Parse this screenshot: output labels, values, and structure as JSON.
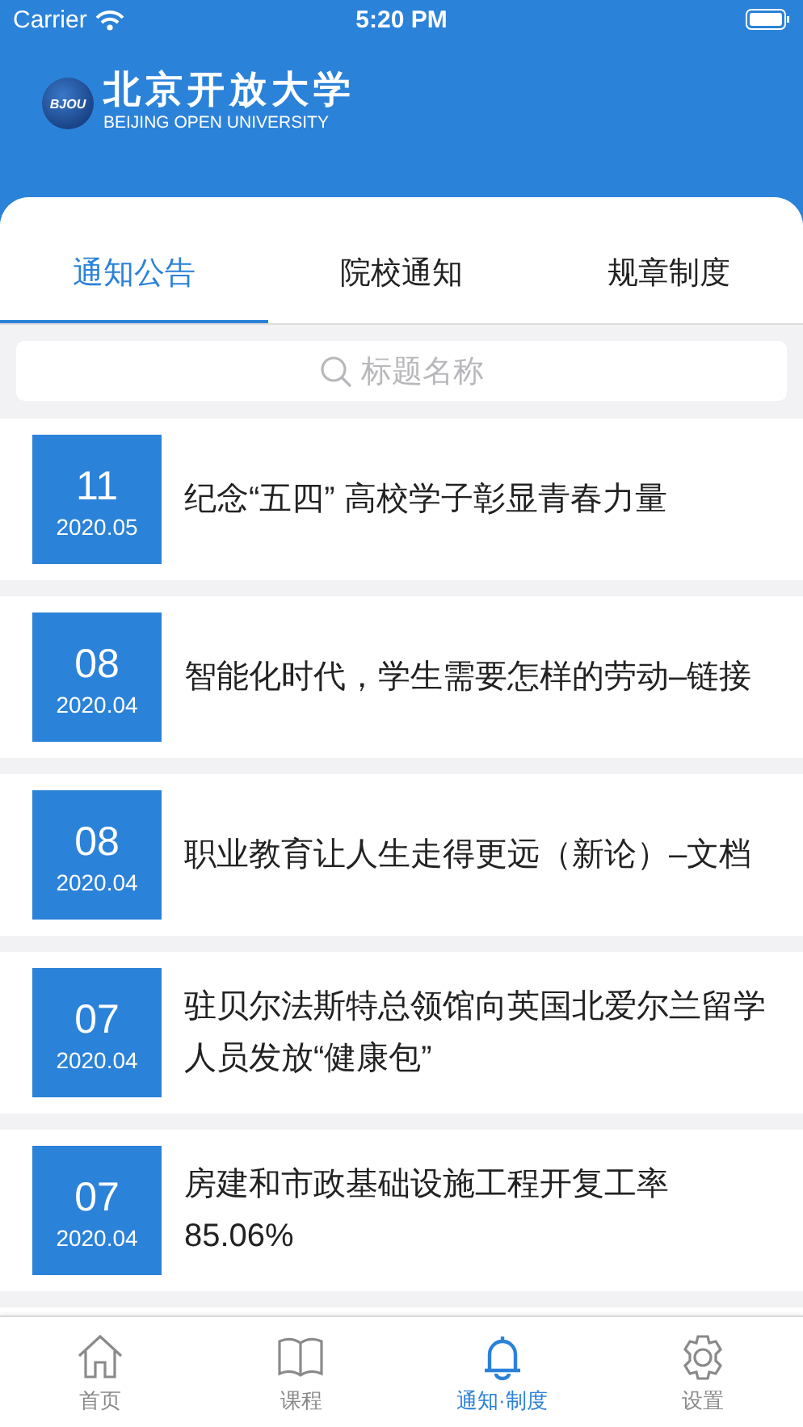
{
  "status_bar": {
    "carrier": "Carrier",
    "time": "5:20 PM"
  },
  "header": {
    "emblem_text": "BJOU",
    "title": "北京开放大学",
    "subtitle": "BEIJING OPEN UNIVERSITY"
  },
  "tabs": [
    {
      "label": "通知公告",
      "selected": true
    },
    {
      "label": "院校通知",
      "selected": false
    },
    {
      "label": "规章制度",
      "selected": false
    }
  ],
  "search": {
    "placeholder": "标题名称"
  },
  "notices": [
    {
      "day": "11",
      "month": "2020.05",
      "title": "纪念“五四” 高校学子彰显青春力量"
    },
    {
      "day": "08",
      "month": "2020.04",
      "title": "智能化时代，学生需要怎样的劳动–链接"
    },
    {
      "day": "08",
      "month": "2020.04",
      "title": "职业教育让人生走得更远（新论）–文档"
    },
    {
      "day": "07",
      "month": "2020.04",
      "title": "驻贝尔法斯特总领馆向英国北爱尔兰留学人员发放“健康包”"
    },
    {
      "day": "07",
      "month": "2020.04",
      "title": "房建和市政基础设施工程开复工率85.06%"
    }
  ],
  "tab_bar": [
    {
      "kind": "home",
      "label": "首页",
      "selected": false
    },
    {
      "kind": "book",
      "label": "课程",
      "selected": false
    },
    {
      "kind": "bell",
      "label": "通知·制度",
      "selected": true
    },
    {
      "kind": "gear",
      "label": "设置",
      "selected": false
    }
  ]
}
